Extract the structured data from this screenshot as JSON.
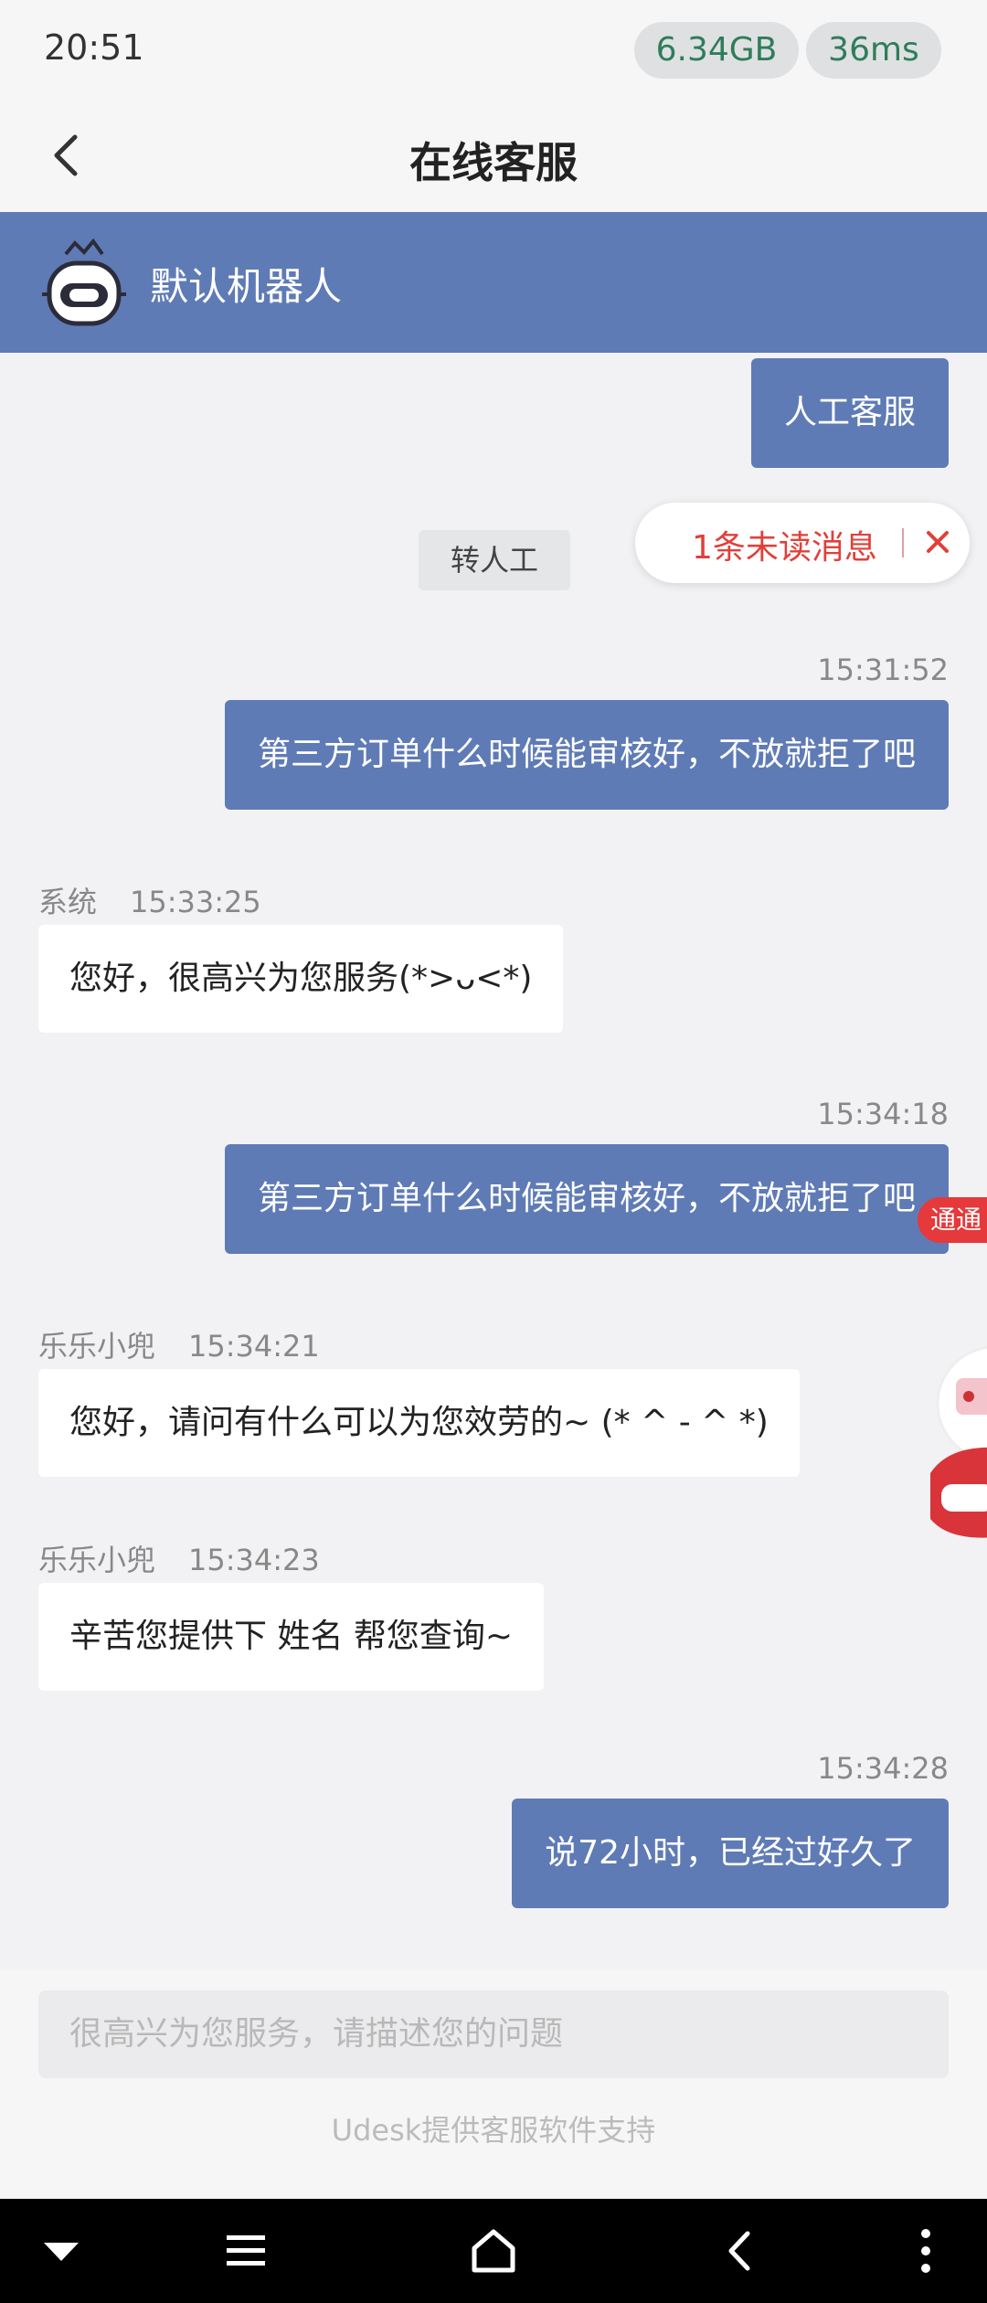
{
  "status_bar": {
    "time": "20:51",
    "memory": "6.34GB",
    "latency": "36ms"
  },
  "header": {
    "title": "在线客服"
  },
  "agent": {
    "name": "默认机器人"
  },
  "messages": {
    "quick_reply": "人工客服",
    "transfer_chip": "转人工",
    "unread_notice": "1条未读消息",
    "m1": {
      "time": "15:31:52",
      "text": "第三方订单什么时候能审核好，不放就拒了吧"
    },
    "m2": {
      "sender": "系统",
      "time": "15:33:25",
      "text": "您好，很高兴为您服务(*>ᴗ<*)"
    },
    "m3": {
      "time": "15:34:18",
      "text": "第三方订单什么时候能审核好，不放就拒了吧"
    },
    "m4": {
      "sender": "乐乐小兜",
      "time": "15:34:21",
      "text": "您好，请问有什么可以为您效劳的~ (* ^ - ^ *)"
    },
    "m5": {
      "sender": "乐乐小兜",
      "time": "15:34:23",
      "text": "辛苦您提供下 姓名 帮您查询~"
    },
    "m6": {
      "time": "15:34:28",
      "text": "说72小时，已经过好久了"
    }
  },
  "float_widget": {
    "label": "通通"
  },
  "input": {
    "placeholder": "很高兴为您服务，请描述您的问题"
  },
  "footer": {
    "powered_by": "Udesk提供客服软件支持"
  },
  "colors": {
    "accent": "#5f7bb6",
    "unread_red": "#e0403a",
    "background": "#f2f2f4"
  }
}
